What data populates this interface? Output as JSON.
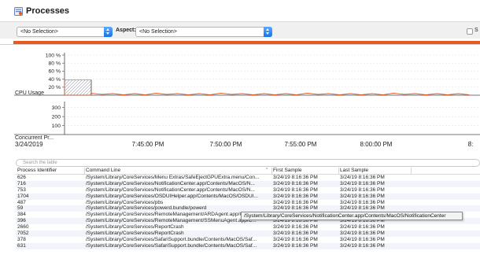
{
  "header": {
    "title": "Processes",
    "icon": "processes-icon"
  },
  "toolbar": {
    "selection_value": "<No Selection>",
    "aspect_label": "Aspect:",
    "aspect_value": "<No Selection>",
    "checkbox_label": "S",
    "accent_color": "#e8591e"
  },
  "chart_data": [
    {
      "type": "area",
      "ylabel": "CPU Usage",
      "yticks": [
        "100 %",
        "80 %",
        "60 %",
        "40 %",
        "20 %"
      ],
      "ylim": [
        0,
        100
      ],
      "series_color": "#e8591e",
      "x": [
        "7:41",
        "7:42",
        "7:43",
        "7:44",
        "7:45",
        "7:46",
        "7:47",
        "7:48",
        "7:49",
        "7:50",
        "7:51",
        "7:52",
        "7:53",
        "7:54",
        "7:55",
        "7:56",
        "7:57",
        "7:58",
        "7:59",
        "8:00",
        "8:01"
      ],
      "values": [
        38,
        38,
        38,
        5,
        4,
        4,
        5,
        4,
        4,
        5,
        4,
        4,
        4,
        5,
        4,
        4,
        4,
        5,
        4,
        4,
        4
      ]
    },
    {
      "type": "line",
      "ylabel": "Concurrent Pr...",
      "yticks": [
        "300",
        "200",
        "100"
      ],
      "ylim": [
        0,
        350
      ]
    }
  ],
  "axis": {
    "start_date": "3/24/2019",
    "ticks": [
      "7:45:00 PM",
      "7:50:00 PM",
      "7:55:00 PM",
      "8:00:00 PM",
      "8:"
    ]
  },
  "search": {
    "placeholder": "Search the table"
  },
  "table": {
    "columns": [
      "Process Identifier",
      "Command Line",
      "First Sample",
      "Last Sample"
    ],
    "rows": [
      [
        "626",
        "/System/Library/CoreServices/Menu Extras/SafeEjectGPUExtra.menu/Con...",
        "3/24/19 8:16:36 PM",
        "3/24/19 8:16:36 PM"
      ],
      [
        "716",
        "/System/Library/CoreServices/NotificationCenter.app/Contents/MacOS/N...",
        "3/24/19 8:16:36 PM",
        "3/24/19 8:16:36 PM"
      ],
      [
        "753",
        "/System/Library/CoreServices/NotificationCenter.app/Contents/MacOS/N...",
        "3/24/19 8:16:36 PM",
        "3/24/19 8:16:36 PM"
      ],
      [
        "1704",
        "/System/Library/CoreServices/OSDUIHelper.app/Contents/MacOS/OSDUI...",
        "3/24/19 8:16:36 PM",
        "3/24/19 8:16:36 PM"
      ],
      [
        "487",
        "/System/Library/CoreServices/pbs",
        "3/24/19 8:16:36 PM",
        "3/24/19 8:16:36 PM"
      ],
      [
        "59",
        "/System/Library/CoreServices/powerd.bundle/powerd",
        "3/24/19 8:16:36 PM",
        "3/24/19 8:16:36 PM"
      ],
      [
        "384",
        "/System/Library/CoreServices/RemoteManagement/ARDAgent.app/Conte...",
        "3/24/19 8:16:36 PM",
        "3/24/19 8:16:36 PM"
      ],
      [
        "396",
        "/System/Library/CoreServices/RemoteManagement/SSMenuAgent.app/C...",
        "3/24/19 8:16:36 PM",
        "3/24/19 8:16:36 PM"
      ],
      [
        "2660",
        "/System/Library/CoreServices/ReportCrash",
        "3/24/19 8:16:36 PM",
        "3/24/19 8:16:36 PM"
      ],
      [
        "7052",
        "/System/Library/CoreServices/ReportCrash",
        "3/24/19 8:16:36 PM",
        "3/24/19 8:16:36 PM"
      ],
      [
        "378",
        "/System/Library/CoreServices/SafariSupport.bundle/Contents/MacOS/Saf...",
        "3/24/19 8:16:36 PM",
        "3/24/19 8:16:36 PM"
      ],
      [
        "631",
        "/System/Library/CoreServices/SafariSupport.bundle/Contents/MacOS/Saf...",
        "3/24/19 8:16:36 PM",
        "3/24/19 8:16:36 PM"
      ]
    ]
  },
  "tooltip": {
    "text": "/System/Library/CoreServices/NotificationCenter.app/Contents/MacOS/NotificationCenter"
  }
}
